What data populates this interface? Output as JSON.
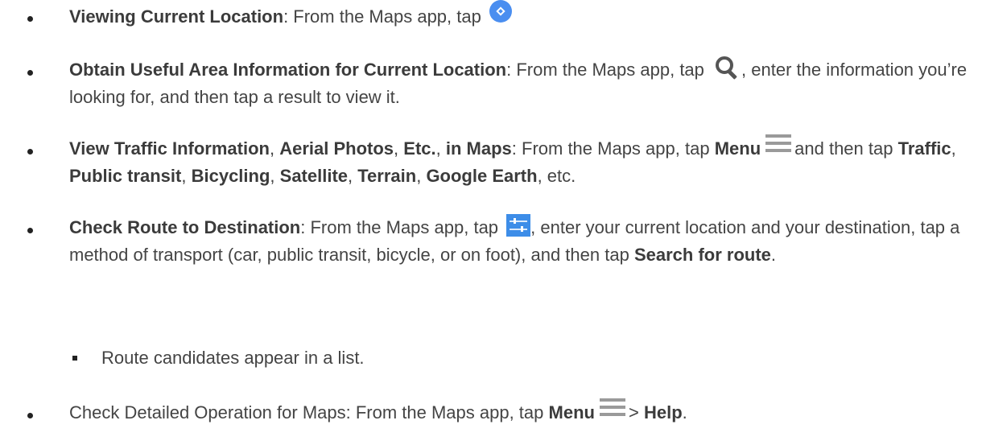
{
  "items": [
    {
      "title": "Viewing Current Location",
      "sep": ": ",
      "text": "From the Maps app, tap"
    },
    {
      "title": "Obtain Useful Area Information for Current Location",
      "sep": ": ",
      "text_before": "From the Maps app, tap",
      "text_after": ", enter the information you’re looking for, and then tap a result to view it."
    },
    {
      "title_parts": [
        "View Traffic Information",
        "Aerial Photos",
        "Etc.",
        "in Maps"
      ],
      "comma": ", ",
      "sep": ": ",
      "text_before": "From the Maps app, tap",
      "menu_label": "Menu",
      "text_mid": "and then tap",
      "options": [
        "Traffic",
        "Public transit",
        "Bicycling",
        "Satellite",
        "Terrain",
        "Google Earth"
      ],
      "text_end": ", etc."
    },
    {
      "title": "Check Route to Destination",
      "sep": ": ",
      "text_before": "From the Maps app, tap",
      "text_after": ", enter your current location and your destination, tap a method of transport (car, public transit, bicycle, or on foot), and then tap",
      "action": "Search for route",
      "end": "."
    },
    {
      "sub": "Route candidates appear in a list."
    },
    {
      "text_before": "Check Detailed Operation for Maps: From the Maps app, tap",
      "menu_label": "Menu",
      "arrow": ">",
      "help_label": "Help",
      "end": "."
    }
  ],
  "icons": {
    "location": "directions-icon",
    "search": "search-icon",
    "menu": "menu-icon",
    "route": "route-settings-icon"
  },
  "colors": {
    "text": "#444444",
    "accent_blue": "#4a8ef0"
  }
}
